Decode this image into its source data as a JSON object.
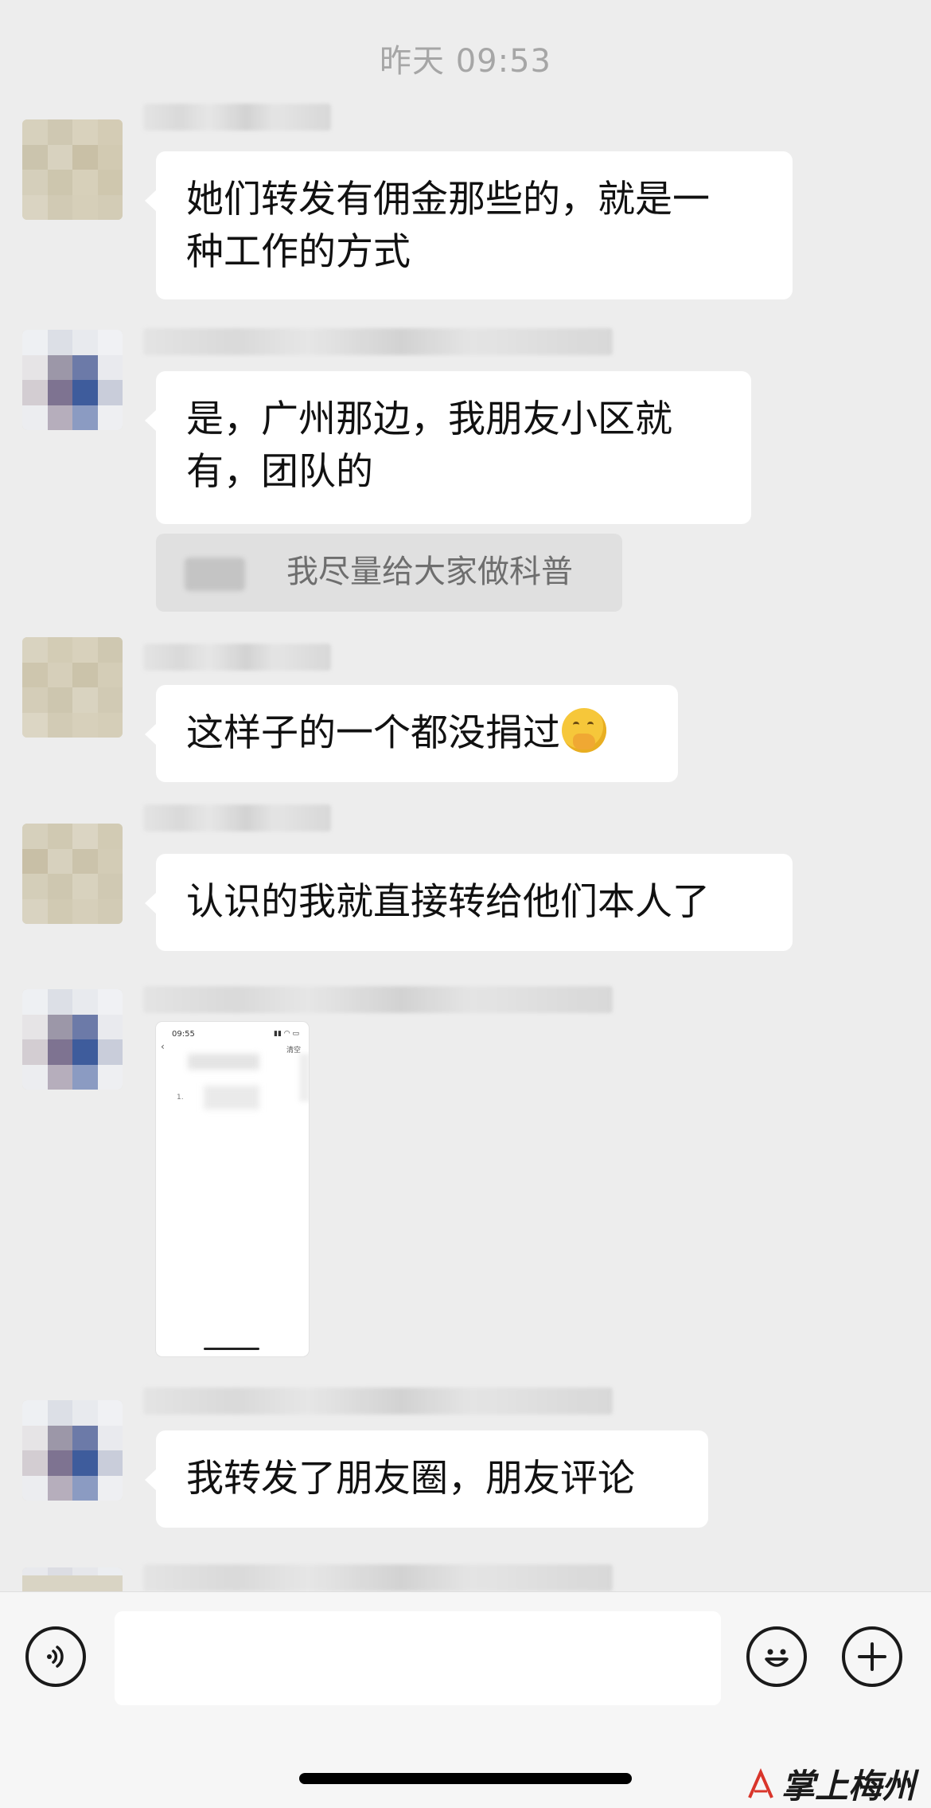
{
  "chat": {
    "timestamp": "昨天 09:53",
    "messages": [
      {
        "type": "text",
        "lines": [
          "她们转发有佣金那些的，就是一",
          "种工作的方式"
        ]
      },
      {
        "type": "text",
        "lines": [
          "是，广州那边，我朋友小区就",
          "有，团队的"
        ]
      },
      {
        "type": "quote",
        "text": "我尽量给大家做科普"
      },
      {
        "type": "text",
        "text": "这样子的一个都没捐过",
        "emoji": "hand-over-mouth-emoji"
      },
      {
        "type": "text",
        "text": "认识的我就直接转给他们本人了"
      },
      {
        "type": "image",
        "thumb_time": "09:55",
        "thumb_action": "清空",
        "thumb_num": "1."
      },
      {
        "type": "text",
        "text": "我转发了朋友圈，朋友评论"
      }
    ]
  },
  "input_bar": {
    "voice_icon": "voice-icon",
    "input_value": "",
    "emoji_icon": "emoji-icon",
    "add_icon": "plus-icon"
  },
  "watermark": {
    "text": "掌上梅州"
  },
  "colors": {
    "background": "#ededed",
    "bubble": "#ffffff",
    "timestamp": "#a6a6a6"
  }
}
